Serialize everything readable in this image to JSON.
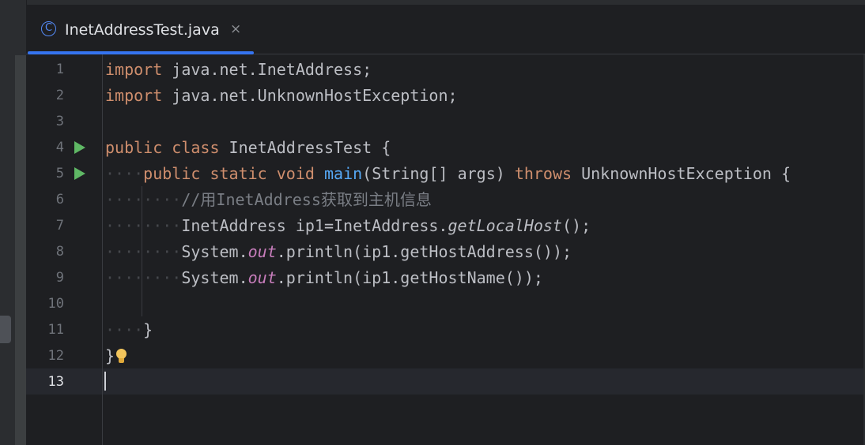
{
  "tab": {
    "icon_letter": "C",
    "title": "InetAddressTest.java",
    "close_glyph": "×"
  },
  "editor": {
    "lines": [
      {
        "number": "1"
      },
      {
        "number": "2"
      },
      {
        "number": "3"
      },
      {
        "number": "4"
      },
      {
        "number": "5"
      },
      {
        "number": "6"
      },
      {
        "number": "7"
      },
      {
        "number": "8"
      },
      {
        "number": "9"
      },
      {
        "number": "10"
      },
      {
        "number": "11"
      },
      {
        "number": "12"
      },
      {
        "number": "13"
      }
    ],
    "code": {
      "l1_kw": "import",
      "l1_rest": " java.net.InetAddress;",
      "l2_kw": "import",
      "l2_rest": " java.net.UnknownHostException;",
      "l4_kw1": "public",
      "l4_kw2": "class",
      "l4_rest": " InetAddressTest {",
      "l5_kw1": "public",
      "l5_kw2": "static",
      "l5_kw3": "void",
      "l5_fn": "main",
      "l5_mid": "(String[] args) ",
      "l5_kw4": "throws",
      "l5_rest": " UnknownHostException {",
      "l6_comment": "//用InetAddress获取到主机信息",
      "l7_a": "InetAddress ip1=InetAddress.",
      "l7_method": "getLocalHost",
      "l7_b": "();",
      "l8_a": "System.",
      "l8_field": "out",
      "l8_b": ".println(ip1.getHostAddress());",
      "l9_a": "System.",
      "l9_field": "out",
      "l9_b": ".println(ip1.getHostName());",
      "l11": "}",
      "l12": "}"
    },
    "current_line": "13"
  },
  "colors": {
    "keyword": "#cf8e6d",
    "function": "#56a8f5",
    "static_field": "#c77dbb",
    "comment": "#7a7e85",
    "text": "#bcbec4",
    "tab_underline": "#3574f0"
  },
  "icons": [
    "class-icon",
    "close-icon",
    "run-gutter-icon",
    "intention-bulb-icon"
  ]
}
